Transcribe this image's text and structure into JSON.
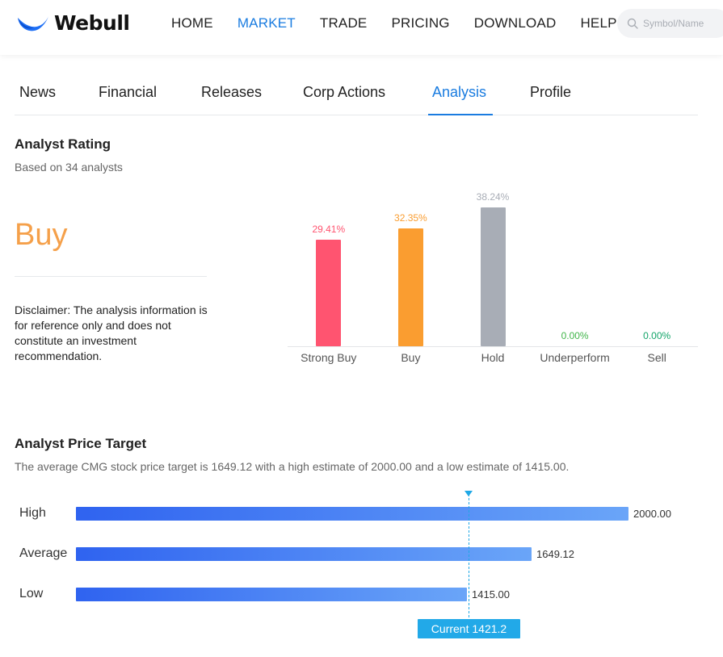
{
  "header": {
    "brand": "Webull",
    "nav": [
      {
        "label": "HOME",
        "active": false
      },
      {
        "label": "MARKET",
        "active": true
      },
      {
        "label": "TRADE",
        "active": false
      },
      {
        "label": "PRICING",
        "active": false
      },
      {
        "label": "DOWNLOAD",
        "active": false
      },
      {
        "label": "HELP",
        "active": false
      }
    ],
    "search": {
      "placeholder": "Symbol/Name",
      "icon": "search-icon"
    }
  },
  "tabs": [
    {
      "label": "News",
      "active": false
    },
    {
      "label": "Financial",
      "active": false
    },
    {
      "label": "Releases",
      "active": false
    },
    {
      "label": "Corp Actions",
      "active": false
    },
    {
      "label": "Analysis",
      "active": true
    },
    {
      "label": "Profile",
      "active": false
    }
  ],
  "analyst_rating": {
    "title": "Analyst Rating",
    "subtitle": "Based on 34 analysts",
    "rating": "Buy",
    "disclaimer": "Disclaimer: The analysis information is for reference only and does not constitute an investment recommendation."
  },
  "chart_data": {
    "type": "bar",
    "categories": [
      "Strong Buy",
      "Buy",
      "Hold",
      "Underperform",
      "Sell"
    ],
    "values": [
      29.41,
      32.35,
      38.24,
      0.0,
      0.0
    ],
    "value_labels": [
      "29.41%",
      "32.35%",
      "38.24%",
      "0.00%",
      "0.00%"
    ],
    "colors": [
      "#ff5470",
      "#fa9d30",
      "#a8adb6",
      "#41b54a",
      "#14a56a"
    ],
    "ylim": [
      0,
      38.24
    ]
  },
  "price_target": {
    "title": "Analyst Price Target",
    "summary": "The average CMG stock price target is 1649.12 with a high estimate of 2000.00 and a low estimate of 1415.00.",
    "rows": [
      {
        "label": "High",
        "value": 2000.0,
        "value_label": "2000.00"
      },
      {
        "label": "Average",
        "value": 1649.12,
        "value_label": "1649.12"
      },
      {
        "label": "Low",
        "value": 1415.0,
        "value_label": "1415.00"
      }
    ],
    "current": {
      "value": 1421.2,
      "label": "Current 1421.2"
    }
  }
}
